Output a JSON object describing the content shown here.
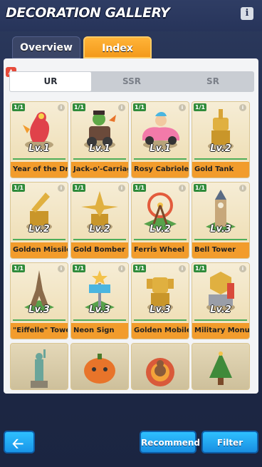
{
  "header": {
    "title": "DECORATION GALLERY",
    "info_icon": "i"
  },
  "tabs": [
    {
      "label": "Overview"
    },
    {
      "label": "Index",
      "active": true
    }
  ],
  "rarity_tabs": [
    {
      "label": "UR",
      "active": true
    },
    {
      "label": "SSR"
    },
    {
      "label": "SR"
    }
  ],
  "cards": [
    {
      "name": "Year of the Dragon",
      "level": "Lv.1",
      "count": "1/1",
      "icon": "dragon-statue"
    },
    {
      "name": "Jack-o'-Carriage",
      "level": "Lv.1",
      "count": "1/1",
      "icon": "pumpkin-carriage"
    },
    {
      "name": "Rosy Cabriolet",
      "level": "Lv.1",
      "count": "1/1",
      "icon": "pink-car"
    },
    {
      "name": "Gold Tank",
      "level": "Lv.2",
      "count": "1/1",
      "icon": "gold-tank"
    },
    {
      "name": "Golden Missile Vehicle",
      "level": "Lv.2",
      "count": "1/1",
      "icon": "gold-missile"
    },
    {
      "name": "Gold Bomber",
      "level": "Lv.2",
      "count": "1/1",
      "icon": "gold-bomber"
    },
    {
      "name": "Ferris Wheel",
      "level": "Lv.2",
      "count": "1/1",
      "icon": "ferris-wheel"
    },
    {
      "name": "Bell Tower",
      "level": "Lv.3",
      "count": "1/1",
      "icon": "bell-tower"
    },
    {
      "name": "\"Eiffelle\" Tower",
      "level": "Lv.3",
      "count": "1/1",
      "icon": "eiffel-tower"
    },
    {
      "name": "Neon Sign",
      "level": "Lv.3",
      "count": "1/1",
      "icon": "neon-sign"
    },
    {
      "name": "Golden Mobile Suit",
      "level": "Lv.3",
      "count": "1/1",
      "icon": "gold-mech"
    },
    {
      "name": "Military Monument",
      "level": "Lv.2",
      "count": "1/1",
      "icon": "military-monument"
    }
  ],
  "partial_cards": [
    {
      "icon": "statue-of-liberty"
    },
    {
      "icon": "pumpkin-monster"
    },
    {
      "icon": "turkey"
    },
    {
      "icon": "christmas-tree"
    }
  ],
  "buttons": {
    "back_icon": "arrow-left-icon",
    "recommend": "Recommend",
    "filter": "Filter"
  },
  "colors": {
    "active_tab": "#f39a1b",
    "card_label": "#f29c2c",
    "button_blue": "#1a8fe2",
    "count_badge": "#2f8b3a"
  }
}
